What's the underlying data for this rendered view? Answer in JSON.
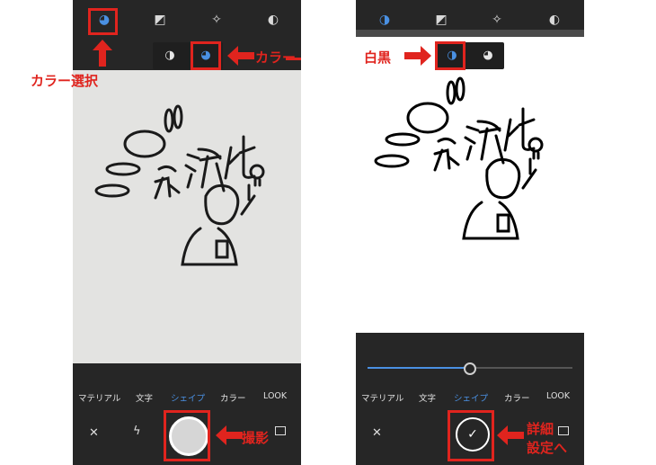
{
  "left": {
    "modes": [
      "マテリアル",
      "文字",
      "シェイプ",
      "カラー",
      "LOOK"
    ],
    "selected_mode": "シェイプ",
    "annotations": {
      "color_select": "カラー選択",
      "color": "カラー",
      "shoot": "撮影"
    }
  },
  "right": {
    "modes": [
      "マテリアル",
      "文字",
      "シェイプ",
      "カラー",
      "LOOK"
    ],
    "selected_mode": "シェイプ",
    "annotations": {
      "bw": "白黒",
      "detail_line1": "詳細",
      "detail_line2": "設定へ"
    }
  },
  "icons": {
    "close": "close-icon",
    "flash": "flash-icon",
    "gallery": "gallery-icon",
    "color_mode": "color-palette-icon",
    "bw_mode": "contrast-icon",
    "crop": "crop-icon",
    "magic": "magic-wand-icon",
    "blend": "blend-icon"
  },
  "colors": {
    "accent": "#4a90e2",
    "annotation": "#e0241e",
    "ui_bg": "#262626"
  }
}
